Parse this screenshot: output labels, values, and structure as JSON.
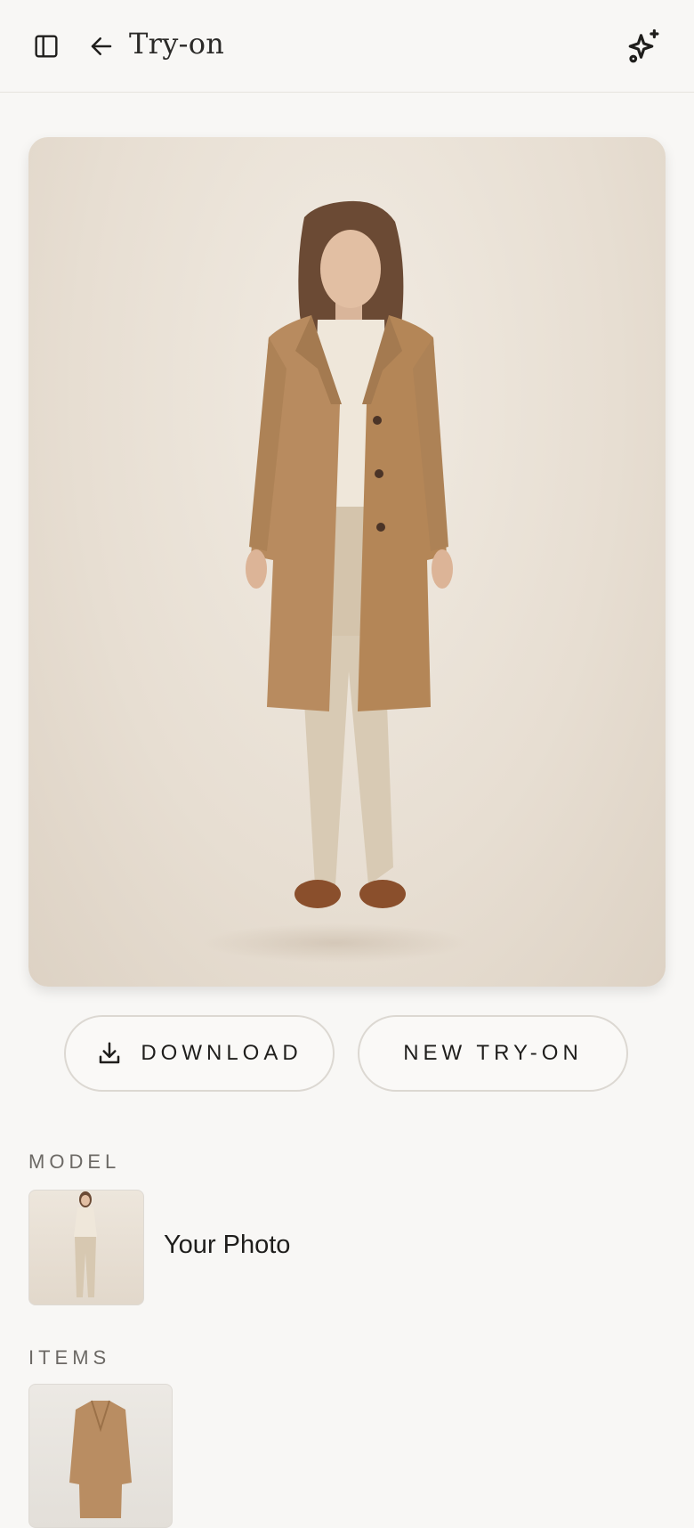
{
  "header": {
    "title": "Try-on",
    "icons": [
      "sidebar-icon",
      "back-arrow-icon",
      "sparkle-icon"
    ]
  },
  "hero": {
    "image": "model-wearing-camel-coat"
  },
  "actions": {
    "download_label": "DOWNLOAD",
    "new_tryon_label": "NEW TRY-ON"
  },
  "model_section": {
    "label": "MODEL",
    "name": "Your Photo"
  },
  "items_section": {
    "label": "ITEMS"
  },
  "colors": {
    "background": "#f8f7f5",
    "coat": "#b98d62",
    "trousers": "#d7c8b1",
    "shoes": "#8a4f2c"
  }
}
